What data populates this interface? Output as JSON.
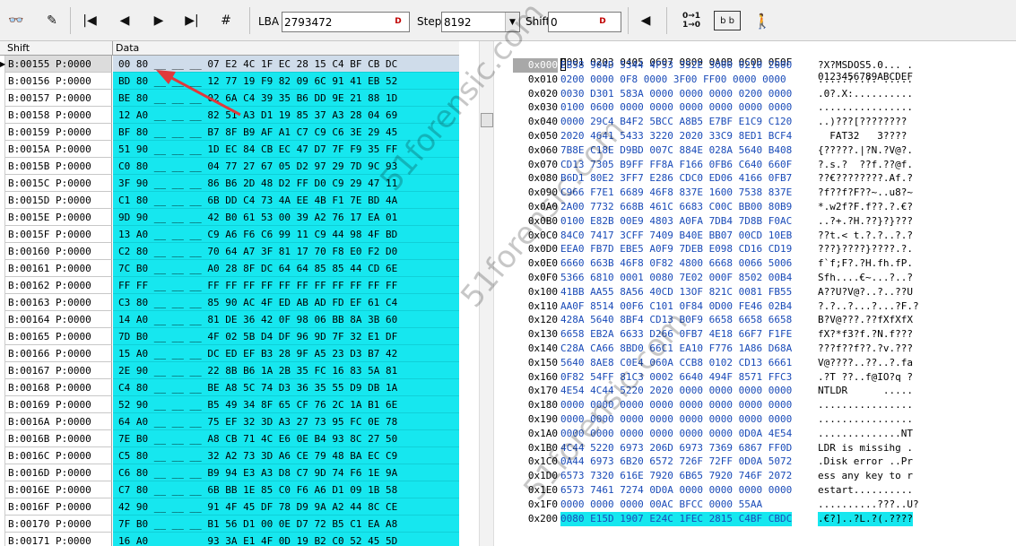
{
  "toolbar": {
    "lba_label": "LBA",
    "lba_value": "2793472",
    "step_label": "Step",
    "step_value": "8192",
    "shift_label": "Shift",
    "shift_value": "0",
    "icons": [
      "binoculars-icon",
      "edit-icon",
      "first-icon",
      "prev-icon",
      "next-icon",
      "last-icon",
      "goto-icon",
      "left-arrow-icon",
      "toggle-bits-icon",
      "binary-view-icon",
      "exit-icon"
    ],
    "glyphs": {
      "binoculars": "👓",
      "edit": "✎",
      "first": "|◀",
      "prev": "◀",
      "next": "▶",
      "last": "▶|",
      "goto": "#",
      "left": "◀",
      "toggle_top": "0→1",
      "toggle_bottom": "1→0",
      "binview": "b b",
      "exit": "🚶",
      "dspin": "D",
      "dropdown": "▼",
      "row_indicator": "▶"
    }
  },
  "left_grid": {
    "col_shift": "Shift",
    "col_data": "Data",
    "rows": [
      {
        "shift": "B:00155 P:0000",
        "data": "00 80 __ __ __ 07 E2 4C 1F EC 28 15 C4 BF CB DC"
      },
      {
        "shift": "B:00156 P:0000",
        "data": "BD 80 __ __ __ 12 77 19 F9 82 09 6C 91 41 EB 52"
      },
      {
        "shift": "B:00157 P:0000",
        "data": "BE 80 __ __ __ 02 6A C4 39 35 B6 DD 9E 21 88 1D"
      },
      {
        "shift": "B:00158 P:0000",
        "data": "12 A0 __ __ __ 82 51 A3 D1 19 85 37 A3 28 04 69"
      },
      {
        "shift": "B:00159 P:0000",
        "data": "BF 80 __ __ __ B7 8F B9 AF A1 C7 C9 C6 3E 29 45"
      },
      {
        "shift": "B:0015A P:0000",
        "data": "51 90 __ __ __ 1D EC 84 CB EC 47 D7 7F F9 35 FF"
      },
      {
        "shift": "B:0015B P:0000",
        "data": "C0 80 __ __ __ 04 77 27 67 05 D2 97 29 7D 9C 93"
      },
      {
        "shift": "B:0015C P:0000",
        "data": "3F 90 __ __ __ 86 B6 2D 48 D2 FF D0 C9 29 47 11"
      },
      {
        "shift": "B:0015D P:0000",
        "data": "C1 80 __ __ __ 6B DD C4 73 4A EE 4B F1 7E BD 4A"
      },
      {
        "shift": "B:0015E P:0000",
        "data": "9D 90 __ __ __ 42 B0 61 53 00 39 A2 76 17 EA 01"
      },
      {
        "shift": "B:0015F P:0000",
        "data": "13 A0 __ __ __ C9 A6 F6 C6 99 11 C9 44 98 4F BD"
      },
      {
        "shift": "B:00160 P:0000",
        "data": "C2 80 __ __ __ 70 64 A7 3F 81 17 70 F8 E0 F2 D0"
      },
      {
        "shift": "B:00161 P:0000",
        "data": "7C B0 __ __ __ A0 28 8F DC 64 64 85 85 44 CD 6E"
      },
      {
        "shift": "B:00162 P:0000",
        "data": "FF FF __ __ __ FF FF FF FF FF FF FF FF FF FF FF"
      },
      {
        "shift": "B:00163 P:0000",
        "data": "C3 80 __ __ __ 85 90 AC 4F ED AB AD FD EF 61 C4"
      },
      {
        "shift": "B:00164 P:0000",
        "data": "14 A0 __ __ __ 81 DE 36 42 0F 98 06 BB 8A 3B 60"
      },
      {
        "shift": "B:00165 P:0000",
        "data": "7D B0 __ __ __ 4F 02 5B D4 DF 96 9D 7F 32 E1 DF"
      },
      {
        "shift": "B:00166 P:0000",
        "data": "15 A0 __ __ __ DC ED EF B3 28 9F A5 23 D3 B7 42"
      },
      {
        "shift": "B:00167 P:0000",
        "data": "2E 90 __ __ __ 22 8B B6 1A 2B 35 FC 16 83 5A 81"
      },
      {
        "shift": "B:00168 P:0000",
        "data": "C4 80 __ __ __ BE A8 5C 74 D3 36 35 55 D9 DB 1A"
      },
      {
        "shift": "B:00169 P:0000",
        "data": "52 90 __ __ __ B5 49 34 8F 65 CF 76 2C 1A B1 6E"
      },
      {
        "shift": "B:0016A P:0000",
        "data": "64 A0 __ __ __ 75 EF 32 3D A3 27 73 95 FC 0E 78"
      },
      {
        "shift": "B:0016B P:0000",
        "data": "7E B0 __ __ __ A8 CB 71 4C E6 0E B4 93 8C 27 50"
      },
      {
        "shift": "B:0016C P:0000",
        "data": "C5 80 __ __ __ 32 A2 73 3D A6 CE 79 48 BA EC C9"
      },
      {
        "shift": "B:0016D P:0000",
        "data": "C6 80 __ __ __ B9 94 E3 A3 D8 C7 9D 74 F6 1E 9A"
      },
      {
        "shift": "B:0016E P:0000",
        "data": "C7 80 __ __ __ 6B BB 1E 85 C0 F6 A6 D1 09 1B 58"
      },
      {
        "shift": "B:0016F P:0000",
        "data": "42 90 __ __ __ 91 4F 45 DF 78 D9 9A A2 44 8C CE"
      },
      {
        "shift": "B:00170 P:0000",
        "data": "7F B0 __ __ __ B1 56 D1 00 0E D7 72 B5 C1 EA A8"
      },
      {
        "shift": "B:00171 P:0000",
        "data": "16 A0 __ __ __ 93 3A E1 4F 0D 19 B2 C0 52 45 5D"
      }
    ]
  },
  "hex_view": {
    "header_hex": "0001 0203 0405 0607 0809 0A0B 0C0D 0E0F",
    "header_ascii": "0123456789ABCDEF",
    "rows": [
      {
        "offset": "0x000",
        "hex": "EB58 904D 5344 4F53 352E 3000 0210 2000",
        "ascii": "?X?MSDOS5.0... ."
      },
      {
        "offset": "0x010",
        "hex": "0200 0000 0F8 0000 3F00 FF00 0000 0000",
        "ascii": ".....?..?. ....."
      },
      {
        "offset": "0x020",
        "hex": "0030 D301 583A 0000 0000 0000 0200 0000",
        "ascii": ".0?.X:.........."
      },
      {
        "offset": "0x030",
        "hex": "0100 0600 0000 0000 0000 0000 0000 0000",
        "ascii": "................"
      },
      {
        "offset": "0x040",
        "hex": "0000 29C4 B4F2 5BCC A8B5 E7BF E1C9 C120",
        "ascii": "..)???[???????? "
      },
      {
        "offset": "0x050",
        "hex": "2020 4641 5433 3220 2020 33C9 8ED1 BCF4",
        "ascii": "  FAT32   3????"
      },
      {
        "offset": "0x060",
        "hex": "7B8E C18E D9BD 007C 884E 028A 5640 B408",
        "ascii": "{?????.|?N.?V@?."
      },
      {
        "offset": "0x070",
        "hex": "CD13 7305 B9FF FF8A F166 0FB6 C640 660F",
        "ascii": "?.s.?  ??f.??@f."
      },
      {
        "offset": "0x080",
        "hex": "B6D1 80E2 3FF7 E286 CDC0 ED06 4166 0FB7",
        "ascii": "??€????????.Af.?"
      },
      {
        "offset": "0x090",
        "hex": "C966 F7E1 6689 46F8 837E 1600 7538 837E",
        "ascii": "?f??f?F??~..u8?~"
      },
      {
        "offset": "0x0A0",
        "hex": "2A00 7732 668B 461C 6683 C00C BB00 80B9",
        "ascii": "*.w2f?F.f??.?.€?"
      },
      {
        "offset": "0x0B0",
        "hex": "0100 E82B 00E9 4803 A0FA 7DB4 7D8B F0AC",
        "ascii": "..?+.?H.??}?}???"
      },
      {
        "offset": "0x0C0",
        "hex": "84C0 7417 3CFF 7409 B40E BB07 00CD 10EB",
        "ascii": "??t.< t.?.?..?.?"
      },
      {
        "offset": "0x0D0",
        "hex": "EEA0 FB7D EBE5 A0F9 7DEB E098 CD16 CD19",
        "ascii": "???}????}????.?."
      },
      {
        "offset": "0x0E0",
        "hex": "6660 663B 46F8 0F82 4800 6668 0066 5006",
        "ascii": "f`f;F?.?H.fh.fP."
      },
      {
        "offset": "0x0F0",
        "hex": "5366 6810 0001 0080 7E02 000F 8502 00B4",
        "ascii": "Sfh....€~...?..?"
      },
      {
        "offset": "0x100",
        "hex": "41BB AA55 8A56 40CD 13OF 821C 0081 FB55",
        "ascii": "A??U?V@?..?..??U"
      },
      {
        "offset": "0x110",
        "hex": "AA0F 8514 00F6 C101 0F84 0D00 FE46 02B4",
        "ascii": "?.?..?...?...?F.?"
      },
      {
        "offset": "0x120",
        "hex": "428A 5640 8BF4 CD13 B0F9 6658 6658 6658",
        "ascii": "B?V@???.??fXfXfX"
      },
      {
        "offset": "0x130",
        "hex": "6658 EB2A 6633 D266 0FB7 4E18 66F7 F1FE",
        "ascii": "fX?*f3?f.?N.f???"
      },
      {
        "offset": "0x140",
        "hex": "C28A CA66 8BD0 66C1 EA10 F776 1A86 D68A",
        "ascii": "???f??f??.?v.???"
      },
      {
        "offset": "0x150",
        "hex": "5640 8AE8 C0E4 060A CCB8 0102 CD13 6661",
        "ascii": "V@????..??..?.fa"
      },
      {
        "offset": "0x160",
        "hex": "0F82 54FF 81C3 0002 6640 494F 8571 FFC3",
        "ascii": ".?T ??..f@IO?q ?"
      },
      {
        "offset": "0x170",
        "hex": "4E54 4C44 5220 2020 0000 0000 0000 0000",
        "ascii": "NTLDR      ....."
      },
      {
        "offset": "0x180",
        "hex": "0000 0000 0000 0000 0000 0000 0000 0000",
        "ascii": "................"
      },
      {
        "offset": "0x190",
        "hex": "0000 0000 0000 0000 0000 0000 0000 0000",
        "ascii": "................"
      },
      {
        "offset": "0x1A0",
        "hex": "0000 0000 0000 0000 0000 0000 0D0A 4E54",
        "ascii": "..............NT"
      },
      {
        "offset": "0x1B0",
        "hex": "4C44 5220 6973 206D 6973 7369 6867 FF0D",
        "ascii": "LDR is missihg ."
      },
      {
        "offset": "0x1C0",
        "hex": "0A44 6973 6B20 6572 726F 72FF 0D0A 5072",
        "ascii": ".Disk error ..Pr"
      },
      {
        "offset": "0x1D0",
        "hex": "6573 7320 616E 7920 6B65 7920 746F 2072",
        "ascii": "ess any key to r"
      },
      {
        "offset": "0x1E0",
        "hex": "6573 7461 7274 0D0A 0000 0000 0000 0000",
        "ascii": "estart.........."
      },
      {
        "offset": "0x1F0",
        "hex": "0000 0000 0000 00AC BFCC 0000 55AA",
        "ascii": "..........???..U?"
      },
      {
        "offset": "0x200",
        "hex": "0080 E15D 1907 E24C 1FEC 2815 C4BF CBDC",
        "ascii": ".€?]..?L.?(.????"
      }
    ]
  },
  "watermark": {
    "text": "51forensic.com"
  },
  "colors": {
    "highlight": "#16e7ef",
    "hex_text": "#1a4bb8",
    "arrow": "#e0393c"
  }
}
